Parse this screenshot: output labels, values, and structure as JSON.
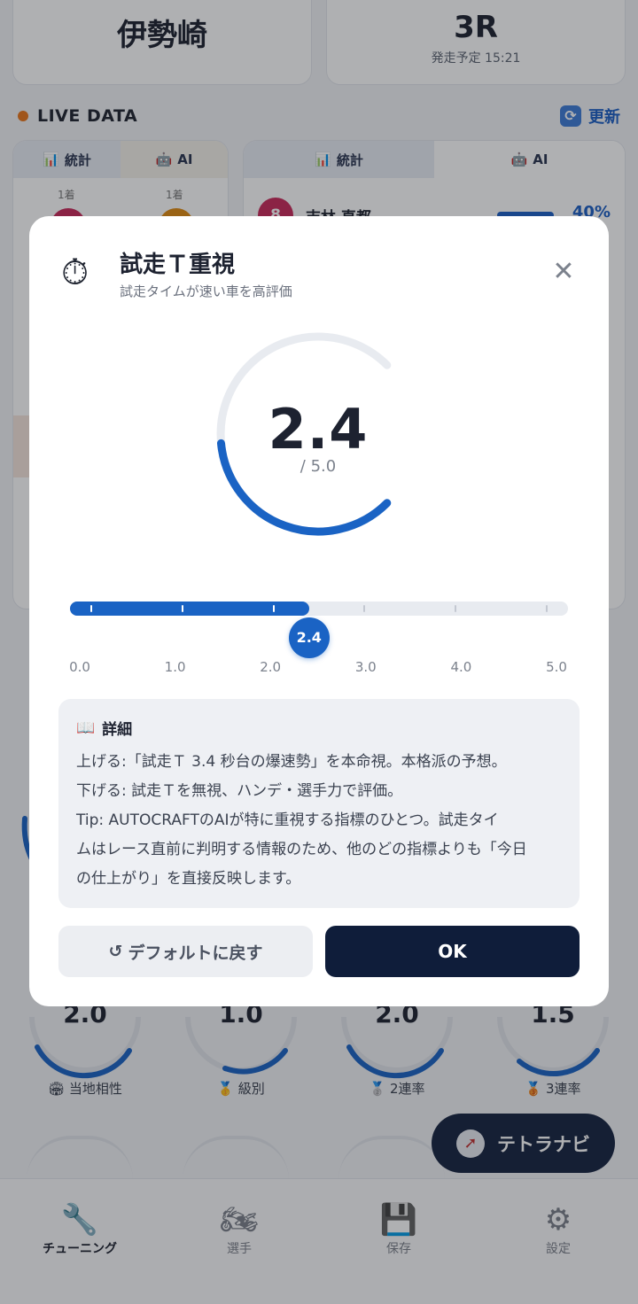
{
  "header": {
    "venue": "伊勢崎",
    "race": "3R",
    "start_time": "発走予定 15:21"
  },
  "live": {
    "label": "LIVE DATA",
    "refresh": "更新"
  },
  "left_card": {
    "tab_stats": "統計",
    "tab_ai": "AI",
    "rank_1": "1着",
    "rank_2": "1着"
  },
  "right_card": {
    "tab_stats": "統計",
    "tab_ai": "AI",
    "player_num": "8",
    "player_name": "吉林 直都",
    "pct": "40%"
  },
  "gauges": [
    {
      "value": "2.0",
      "label": "当地相性",
      "icon": "🏟"
    },
    {
      "value": "1.0",
      "label": "級別",
      "icon": "🥇"
    },
    {
      "value": "2.0",
      "label": "2連率",
      "icon": "🥈"
    },
    {
      "value": "1.5",
      "label": "3連率",
      "icon": "🥉"
    }
  ],
  "fab": {
    "label": "テトラナビ"
  },
  "tabs": [
    {
      "label": "チューニング",
      "icon": "wrench-icon"
    },
    {
      "label": "選手",
      "icon": "motorcycle-icon"
    },
    {
      "label": "保存",
      "icon": "save-icon"
    },
    {
      "label": "設定",
      "icon": "gear-icon"
    }
  ],
  "modal": {
    "title": "試走Ｔ重視",
    "subtitle": "試走タイムが速い車を高評価",
    "value": "2.4",
    "max_label": "/ 5.0",
    "value_num": 2.4,
    "max_num": 5.0,
    "scale": [
      "0.0",
      "1.0",
      "2.0",
      "3.0",
      "4.0",
      "5.0"
    ],
    "detail_heading": "詳細",
    "detail_lines": [
      "上げる:「試走Ｔ 3.4 秒台の爆速勢」を本命視。本格派の予想。",
      "下げる: 試走Ｔを無視、ハンデ・選手力で評価。",
      "Tip: AUTOCRAFTのAIが特に重視する指標のひとつ。試走タイ",
      "ムはレース直前に判明する情報のため、他のどの指標よりも「今日",
      "の仕上がり」を直接反映します。"
    ],
    "reset_button": "デフォルトに戻す",
    "ok_button": "OK"
  },
  "colors": {
    "accent": "#1a63c4",
    "primary_button": "#0f1d3a"
  }
}
